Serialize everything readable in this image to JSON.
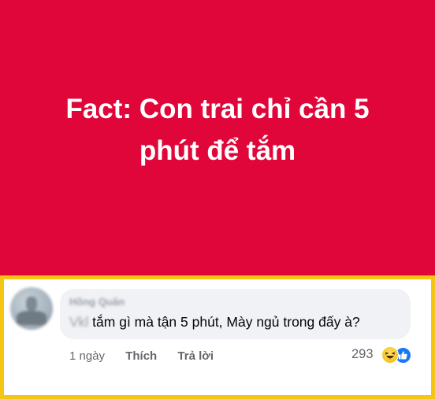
{
  "post": {
    "background_color": "#e0063a",
    "lines": [
      "Fact: Con trai chỉ cần 5",
      "phút để tắm"
    ]
  },
  "comment": {
    "frame_color": "#f5c514",
    "author": "Hồng Quân",
    "text_blurred_prefix": "Vkl",
    "text": " tắm gì mà tận 5 phút, Mày ngủ trong đấy à?",
    "time": "1 ngày",
    "like_label": "Thích",
    "reply_label": "Trả lời",
    "reaction_count": "293",
    "reaction_icons": [
      "haha-icon",
      "like-icon"
    ]
  }
}
